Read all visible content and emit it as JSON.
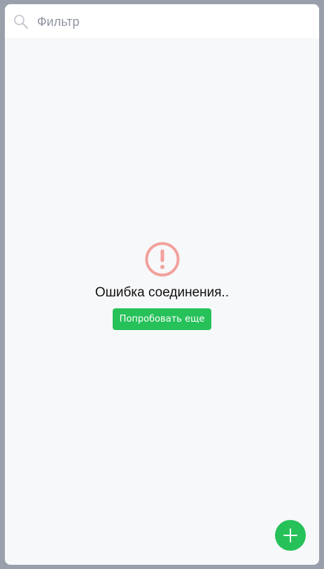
{
  "search": {
    "placeholder": "Фильтр",
    "value": "",
    "icon": "search-icon"
  },
  "error": {
    "icon": "alert-circle-icon",
    "message": "Ошибка соединения..",
    "retry_label": "Попробовать еще"
  },
  "fab": {
    "icon": "plus-icon"
  },
  "colors": {
    "accent": "#27c15a",
    "error_icon": "#f2a19c",
    "panel_background": "#f7f8fa",
    "frame_background": "#9aa0ab"
  }
}
